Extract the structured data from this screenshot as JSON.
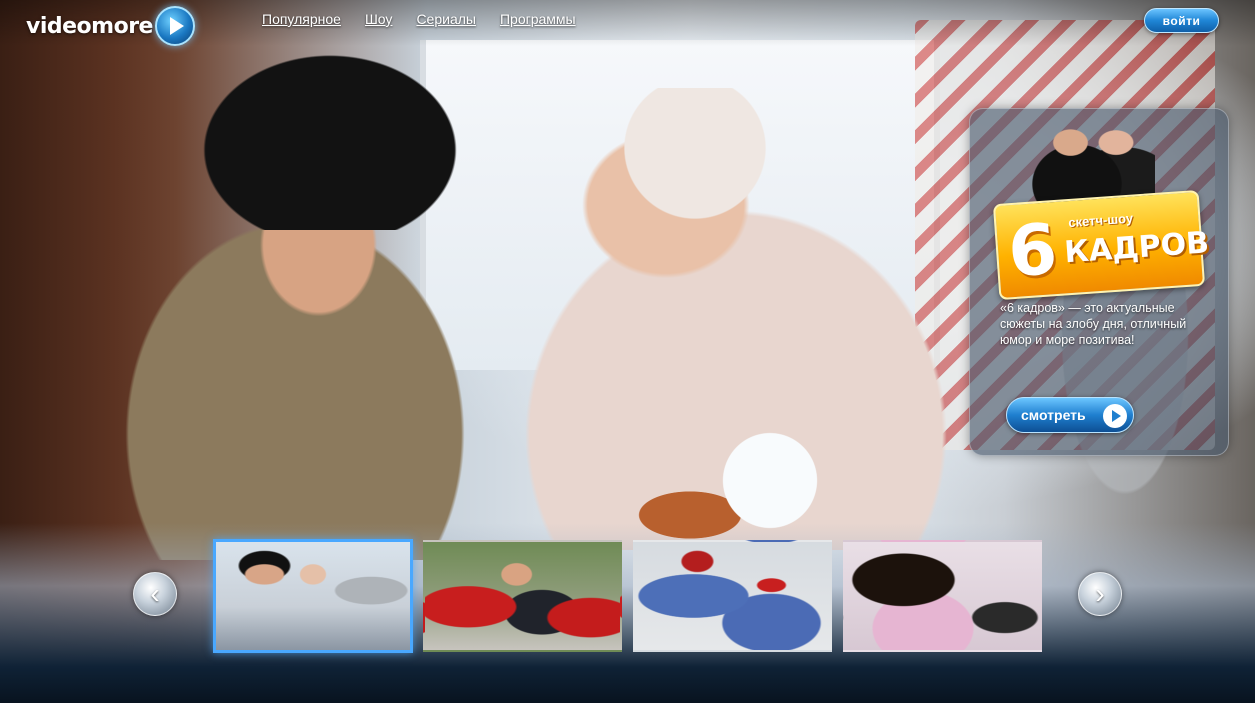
{
  "header": {
    "logo_text": "videomore",
    "nav": [
      {
        "label": "Популярное"
      },
      {
        "label": "Шоу"
      },
      {
        "label": "Сериалы"
      },
      {
        "label": "Программы"
      }
    ],
    "login_label": "войти"
  },
  "promo": {
    "show_number": "6",
    "show_subtitle": "скетч-шоу",
    "show_name": "КАДРОВ",
    "description": "«6 кадров» — это актуальные сюжеты на злобу дня, отличный юмор и море позитива!",
    "watch_label": "смотреть"
  },
  "carousel": {
    "prev_icon": "chevron-left-icon",
    "next_icon": "chevron-right-icon",
    "prev_glyph": "‹",
    "next_glyph": "›",
    "active_index": 0,
    "thumbnail_count": 4
  },
  "colors": {
    "accent": "#1f86d6",
    "active_border": "#49a8ff",
    "promo_logo": "#ffb200"
  }
}
